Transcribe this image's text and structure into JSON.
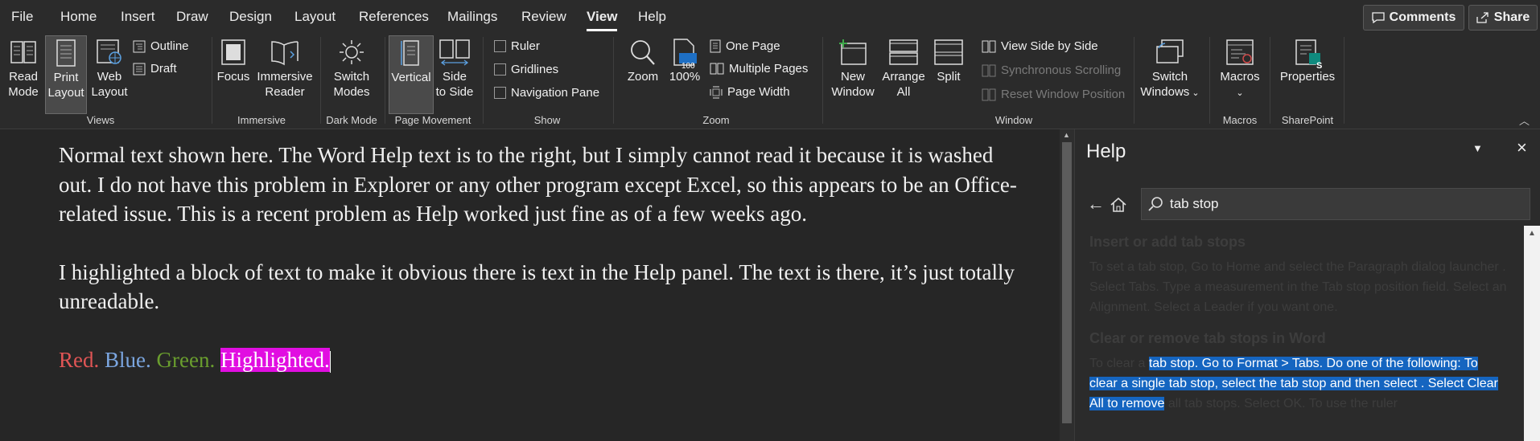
{
  "menu": {
    "items": [
      "File",
      "Home",
      "Insert",
      "Draw",
      "Design",
      "Layout",
      "References",
      "Mailings",
      "Review",
      "View",
      "Help"
    ],
    "active": "View",
    "comments": "Comments",
    "share": "Share"
  },
  "ribbon": {
    "views": {
      "read_mode": [
        "Read",
        "Mode"
      ],
      "print_layout": [
        "Print",
        "Layout"
      ],
      "web_layout": [
        "Web",
        "Layout"
      ],
      "outline": "Outline",
      "draft": "Draft",
      "group": "Views"
    },
    "immersive": {
      "focus": "Focus",
      "reader": [
        "Immersive",
        "Reader"
      ],
      "group": "Immersive"
    },
    "dark_mode": {
      "switch": [
        "Switch",
        "Modes"
      ],
      "group": "Dark Mode"
    },
    "page_movement": {
      "vertical": "Vertical",
      "side": [
        "Side",
        "to Side"
      ],
      "group": "Page Movement"
    },
    "show": {
      "ruler": "Ruler",
      "gridlines": "Gridlines",
      "navigation": "Navigation Pane",
      "group": "Show"
    },
    "zoom": {
      "zoom": "Zoom",
      "hundred": "100%",
      "hundred_badge": "100",
      "one_page": "One Page",
      "multiple_pages": "Multiple Pages",
      "page_width": "Page Width",
      "group": "Zoom"
    },
    "window": {
      "new_window": [
        "New",
        "Window"
      ],
      "arrange_all": [
        "Arrange",
        "All"
      ],
      "split": "Split",
      "side_by_side": "View Side by Side",
      "sync_scroll": "Synchronous Scrolling",
      "reset_pos": "Reset Window Position",
      "switch_windows": [
        "Switch",
        "Windows"
      ],
      "group": "Window"
    },
    "macros": {
      "label": "Macros",
      "group": "Macros"
    },
    "sharepoint": {
      "label": "Properties",
      "group": "SharePoint"
    }
  },
  "document": {
    "para1": "Normal text shown here. The Word Help text is to the right, but I simply cannot read it because it is washed out. I do not have this problem in Explorer or any other program except Excel, so this appears to be an Office-related issue. This is a recent problem as Help worked just fine as of a few weeks ago.",
    "para2": "I highlighted a block of text to make it obvious there is text in the Help panel. The text is there, it’s just totally unreadable.",
    "red": "Red.",
    "blue": "Blue.",
    "green": "Green.",
    "highlighted": "Highlighted."
  },
  "help": {
    "title": "Help",
    "search_value": "tab stop",
    "heading1": "Insert or add tab stops",
    "body1": "To set a tab stop, Go to Home and select the Paragraph dialog launcher . Select Tabs. Type a measurement in the Tab stop position field. Select an Alignment. Select a Leader if you want one.",
    "heading2": "Clear or remove tab stops in Word",
    "body2_pre": "To clear a ",
    "body2_hl": "tab stop. Go to Format > Tabs. Do one of the following: To clear a single tab stop, select the tab stop and then select . Select Clear All to remove",
    "body2_post": " all tab stops. Select OK. To use the ruler"
  },
  "colors": {
    "red": "#e05555",
    "blue": "#7ba6e0",
    "green": "#6a9e2e",
    "highlight": "#e10ee1",
    "selection": "#1565c0"
  }
}
